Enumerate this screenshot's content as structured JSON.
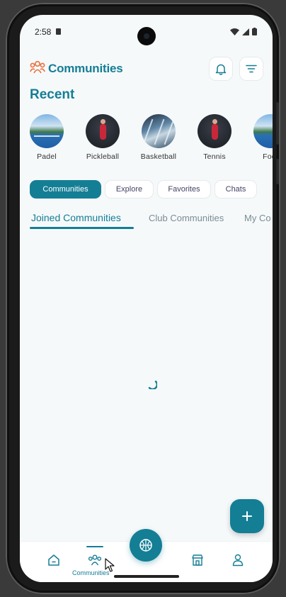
{
  "status_bar": {
    "time": "2:58"
  },
  "header": {
    "title": "Communities"
  },
  "recent": {
    "heading": "Recent",
    "items": [
      {
        "label": "Padel"
      },
      {
        "label": "Pickleball"
      },
      {
        "label": "Basketball"
      },
      {
        "label": "Tennis"
      },
      {
        "label": "Foot"
      }
    ]
  },
  "filters": [
    {
      "label": "Communities",
      "active": true
    },
    {
      "label": "Explore",
      "active": false
    },
    {
      "label": "Favorites",
      "active": false
    },
    {
      "label": "Chats",
      "active": false
    }
  ],
  "tabs": [
    {
      "label": "Joined Communities",
      "active": true
    },
    {
      "label": "Club Communities",
      "active": false
    },
    {
      "label": "My Co",
      "active": false
    }
  ],
  "fab": {
    "icon": "plus-icon"
  },
  "bottom_nav": {
    "active_label": "Communities",
    "items": [
      {
        "icon": "home-icon"
      },
      {
        "icon": "communities-icon"
      },
      {
        "icon": "sports-ball-icon"
      },
      {
        "icon": "store-icon"
      },
      {
        "icon": "profile-icon"
      }
    ]
  },
  "colors": {
    "accent": "#147e95",
    "background": "#f6f9fa"
  }
}
